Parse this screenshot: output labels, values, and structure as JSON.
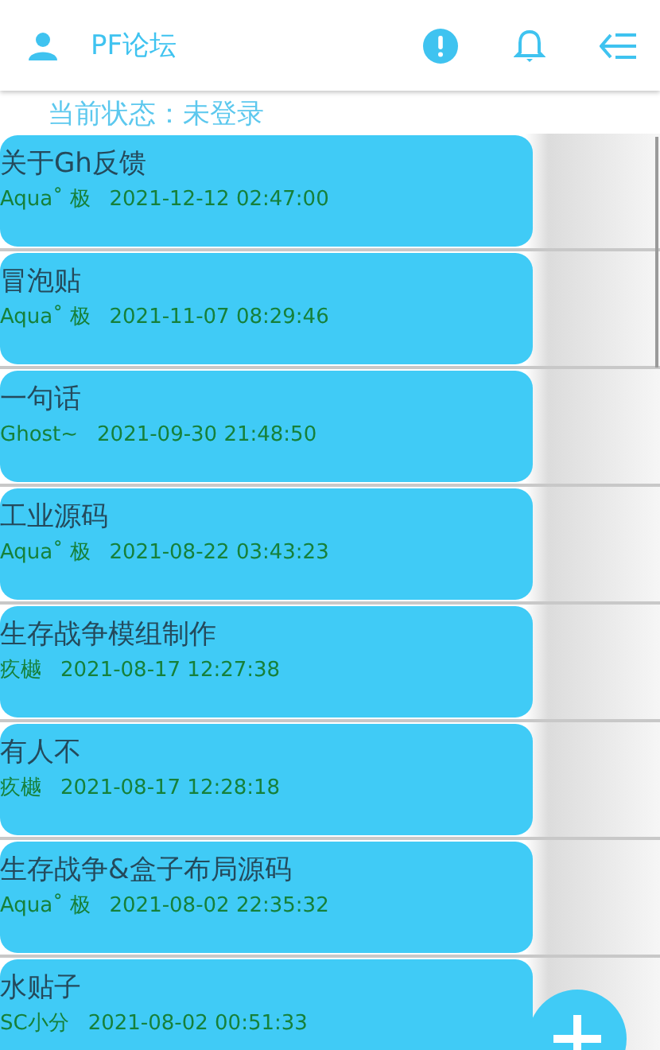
{
  "app_bar": {
    "title": "PF论坛"
  },
  "status": "当前状态：未登录",
  "posts": [
    {
      "title": "关于Gh反馈",
      "author": "Aqua˚ 极",
      "time": "2021-12-12 02:47:00"
    },
    {
      "title": "冒泡贴",
      "author": "Aqua˚ 极",
      "time": "2021-11-07 08:29:46"
    },
    {
      "title": "一句话",
      "author": "Ghost~",
      "time": "2021-09-30 21:48:50"
    },
    {
      "title": "工业源码",
      "author": "Aqua˚ 极",
      "time": "2021-08-22 03:43:23"
    },
    {
      "title": "生存战争模组制作",
      "author": "疚樾",
      "time": "2021-08-17 12:27:38"
    },
    {
      "title": "有人不",
      "author": "疚樾",
      "time": "2021-08-17 12:28:18"
    },
    {
      "title": "生存战争&盒子布局源码",
      "author": "Aqua˚ 极",
      "time": "2021-08-02 22:35:32"
    },
    {
      "title": "水贴子",
      "author": "SC小分",
      "time": "2021-08-02 00:51:33"
    }
  ]
}
